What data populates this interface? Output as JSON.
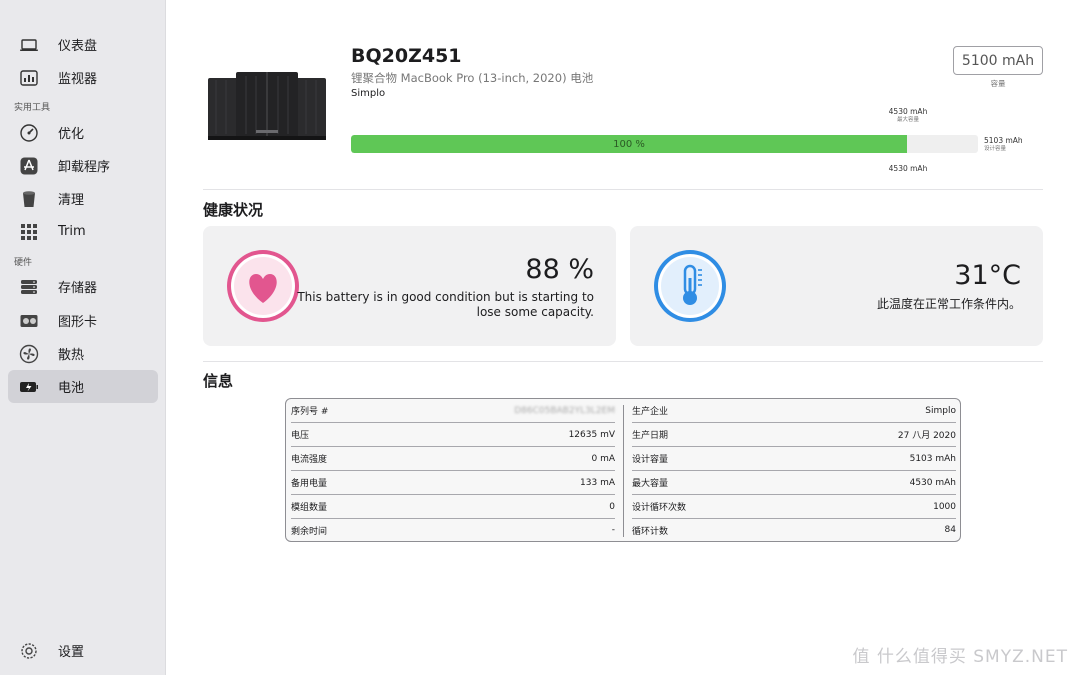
{
  "sidebar": {
    "items_top": [
      {
        "label": "仪表盘",
        "icon": "laptop-icon"
      },
      {
        "label": "监视器",
        "icon": "monitor-chart-icon"
      }
    ],
    "section_tools": "实用工具",
    "items_tools": [
      {
        "label": "优化",
        "icon": "gauge-icon"
      },
      {
        "label": "卸载程序",
        "icon": "appstore-icon"
      },
      {
        "label": "清理",
        "icon": "trash-bin-icon"
      },
      {
        "label": "Trim",
        "icon": "grid-icon"
      }
    ],
    "section_hardware": "硬件",
    "items_hardware": [
      {
        "label": "存储器",
        "icon": "storage-icon"
      },
      {
        "label": "图形卡",
        "icon": "gpu-icon"
      },
      {
        "label": "散热",
        "icon": "fan-icon"
      },
      {
        "label": "电池",
        "icon": "battery-icon",
        "active": true
      }
    ],
    "settings": {
      "label": "设置",
      "icon": "gear-icon"
    }
  },
  "battery": {
    "model": "BQ20Z451",
    "description": "锂聚合物 MacBook Pro (13-inch, 2020) 电池",
    "manufacturer": "Simplo",
    "capacity_value": "5100 mAh",
    "capacity_caption": "容量",
    "max_capacity_value": "4530 mAh",
    "max_capacity_caption": "最大容量",
    "design_capacity_value": "5103 mAh",
    "design_capacity_caption": "设计容量",
    "bar_bottom_value": "4530 mAh",
    "charge_percent_text": "100 %",
    "bar_fill_fraction": 0.887
  },
  "health": {
    "section_title": "健康状况",
    "health_value": "88 %",
    "health_desc_line1": "This battery is in good condition but is starting to",
    "health_desc_line2": "lose some capacity.",
    "temp_value": "31°C",
    "temp_desc": "此温度在正常工作条件内。",
    "colors": {
      "health_accent": "#e2568f",
      "temp_accent": "#2f8de4",
      "progress_fill": "#5fc756"
    }
  },
  "info": {
    "section_title": "信息",
    "left": [
      {
        "key": "序列号 #",
        "value": "D86C05BAB2YL3L2EM",
        "blurred": true
      },
      {
        "key": "电压",
        "value": "12635 mV"
      },
      {
        "key": "电流强度",
        "value": "0 mA"
      },
      {
        "key": "备用电量",
        "value": "133 mA"
      },
      {
        "key": "模组数量",
        "value": "0"
      },
      {
        "key": "剩余时间",
        "value": "-"
      }
    ],
    "right": [
      {
        "key": "生产企业",
        "value": "Simplo"
      },
      {
        "key": "生产日期",
        "value": "27 八月 2020"
      },
      {
        "key": "设计容量",
        "value": "5103 mAh"
      },
      {
        "key": "最大容量",
        "value": "4530 mAh"
      },
      {
        "key": "设计循环次数",
        "value": "1000"
      },
      {
        "key": "循环计数",
        "value": "84"
      }
    ]
  },
  "watermark": "值 什么值得买 SMYZ.NET"
}
